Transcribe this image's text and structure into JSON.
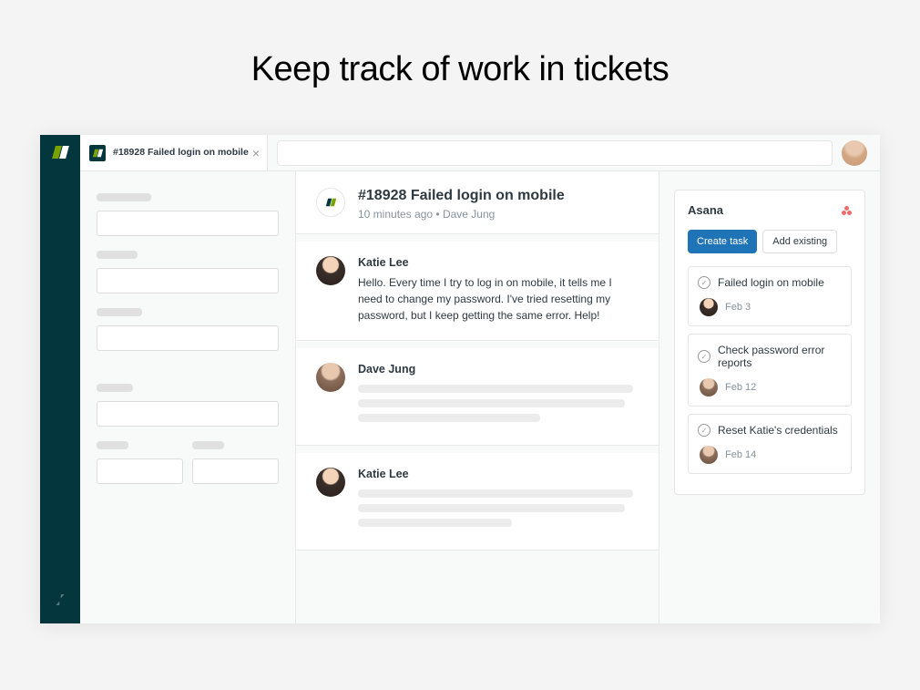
{
  "hero": {
    "title": "Keep track of work in tickets"
  },
  "tab": {
    "title": "#18928 Failed login on mobile"
  },
  "ticket": {
    "title": "#18928 Failed login on mobile",
    "meta_time": "10 minutes ago",
    "meta_sep": "  •  ",
    "meta_author": "Dave Jung"
  },
  "messages": [
    {
      "author": "Katie Lee",
      "text": "Hello. Every time I try to log in on mobile, it tells me I need to change my password. I've tried resetting my password, but I keep getting the same error. Help!"
    },
    {
      "author": "Dave Jung"
    },
    {
      "author": "Katie Lee"
    }
  ],
  "asana": {
    "title": "Asana",
    "create_label": "Create task",
    "add_label": "Add existing",
    "tasks": [
      {
        "name": "Failed login on mobile",
        "date": "Feb 3"
      },
      {
        "name": "Check password error reports",
        "date": "Feb 12"
      },
      {
        "name": "Reset Katie's credentials",
        "date": "Feb 14"
      }
    ]
  }
}
